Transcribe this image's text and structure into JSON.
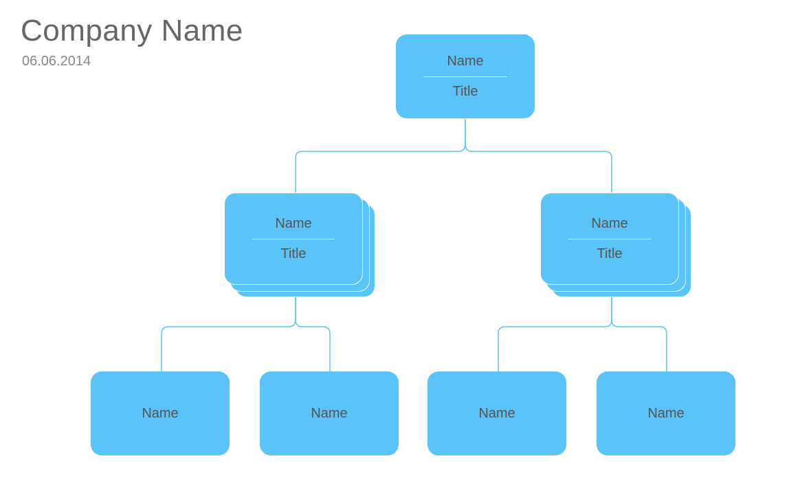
{
  "header": {
    "company_name": "Company Name",
    "date": "06.06.2014"
  },
  "colors": {
    "node_fill": "#5ac3f7",
    "connector": "#5ac3f7",
    "text": "#666666"
  },
  "org": {
    "root": {
      "name": "Name",
      "title": "Title"
    },
    "level2": [
      {
        "name": "Name",
        "title": "Title"
      },
      {
        "name": "Name",
        "title": "Title"
      }
    ],
    "level3": [
      {
        "name": "Name"
      },
      {
        "name": "Name"
      },
      {
        "name": "Name"
      },
      {
        "name": "Name"
      }
    ]
  }
}
